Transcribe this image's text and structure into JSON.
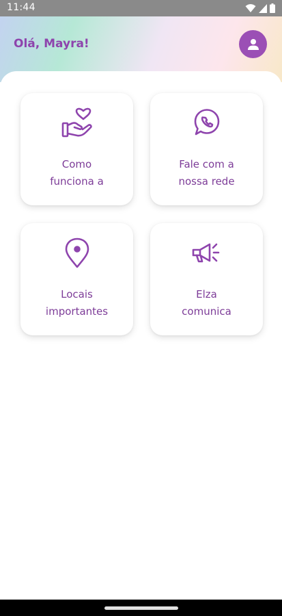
{
  "status_bar": {
    "time": "11:44"
  },
  "header": {
    "greeting": "Olá, Mayra!"
  },
  "cards": [
    {
      "label_line1": "Como",
      "label_line2": "funciona a",
      "icon": "heart-hand-icon"
    },
    {
      "label_line1": "Fale com a",
      "label_line2": "nossa rede",
      "icon": "whatsapp-icon"
    },
    {
      "label_line1": "Locais",
      "label_line2": "importantes",
      "icon": "location-pin-icon"
    },
    {
      "label_line1": "Elza",
      "label_line2": "comunica",
      "icon": "megaphone-icon"
    }
  ],
  "colors": {
    "accent": "#8e44ad",
    "avatar_bg": "#9b4fb5"
  }
}
